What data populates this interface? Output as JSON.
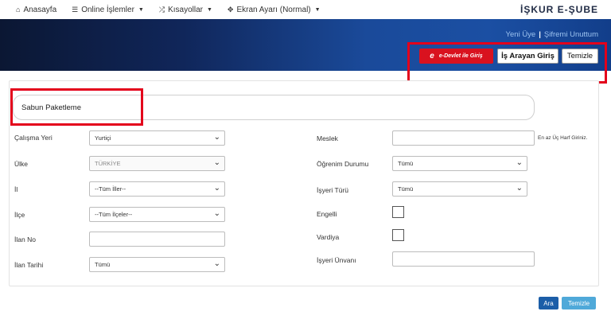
{
  "topnav": {
    "items": [
      {
        "icon": "home-icon",
        "glyph": "⌂",
        "label": "Anasayfa",
        "dropdown": false
      },
      {
        "icon": "list-icon",
        "glyph": "☰",
        "label": "Online İşlemler",
        "dropdown": true
      },
      {
        "icon": "shuffle-icon",
        "glyph": "⤮",
        "label": "Kısayollar",
        "dropdown": true
      },
      {
        "icon": "expand-icon",
        "glyph": "✥",
        "label": "Ekran Ayarı (Normal)",
        "dropdown": true
      }
    ],
    "brand": "İŞKUR E-ŞUBE"
  },
  "banner": {
    "link_new_member": "Yeni Üye",
    "separator": "|",
    "link_forgot_password": "Şifremi Unuttum",
    "edevlet_label": "e-Devlet ile Giriş",
    "edevlet_mark": "e",
    "job_seeker_login": "İş Arayan Giriş",
    "clear_top": "Temizle"
  },
  "search": {
    "value": "Sabun Paketleme"
  },
  "form": {
    "workplace": {
      "label": "Çalışma Yeri",
      "value": "Yurtiçi"
    },
    "country": {
      "label": "Ülke",
      "value": "TÜRKİYE"
    },
    "province": {
      "label": "İl",
      "value": "--Tüm İller--"
    },
    "district": {
      "label": "İlçe",
      "value": "--Tüm İlçeler--"
    },
    "listing_no": {
      "label": "İlan No",
      "value": ""
    },
    "listing_date": {
      "label": "İlan Tarihi",
      "value": "Tümü"
    },
    "occupation": {
      "label": "Meslek",
      "value": "",
      "hint": "En az Üç Harf Giriniz."
    },
    "education": {
      "label": "Öğrenim Durumu",
      "value": "Tümü"
    },
    "employer_type": {
      "label": "İşyeri Türü",
      "value": "Tümü"
    },
    "disabled": {
      "label": "Engelli"
    },
    "shift": {
      "label": "Vardiya"
    },
    "employer_title": {
      "label": "İşyeri Ünvanı",
      "value": ""
    }
  },
  "actions": {
    "search": "Ara",
    "clear": "Temizle"
  },
  "colors": {
    "highlight": "#e3001b",
    "edevlet_red": "#d9121f",
    "primary_blue": "#1c5ea8",
    "light_blue": "#4fa9d9"
  }
}
